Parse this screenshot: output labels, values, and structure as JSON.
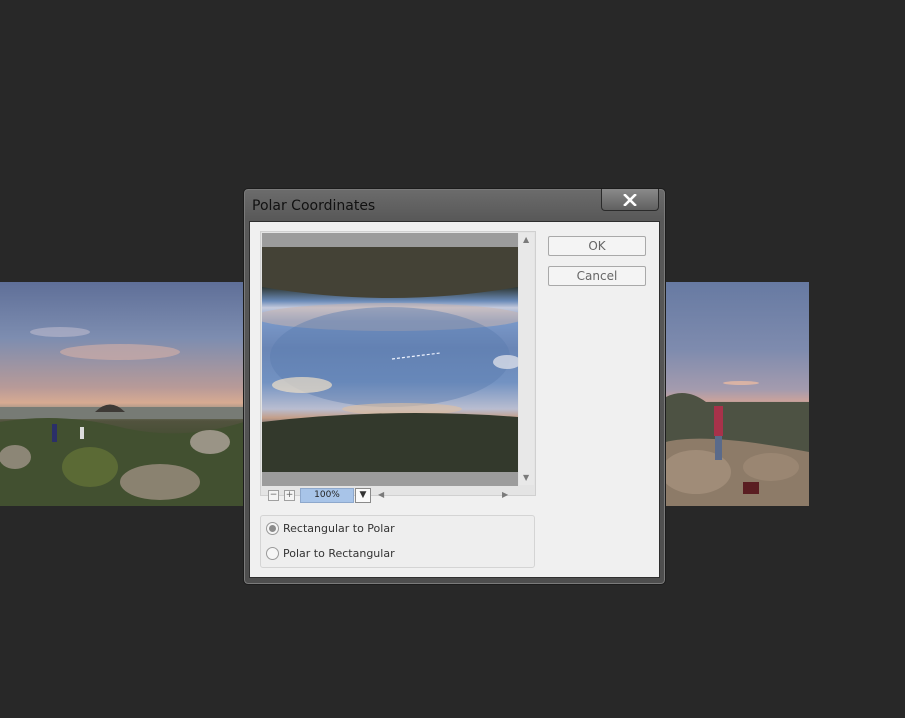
{
  "dialog": {
    "title": "Polar Coordinates",
    "ok_label": "OK",
    "cancel_label": "Cancel",
    "close_icon": "close-icon"
  },
  "preview": {
    "zoom_value": "100%",
    "zoom_out_label": "−",
    "zoom_in_label": "+"
  },
  "options": {
    "items": [
      {
        "label": "Rectangular to Polar",
        "selected": true
      },
      {
        "label": "Polar to Rectangular",
        "selected": false
      }
    ]
  },
  "colors": {
    "background": "#282828",
    "dialog_client": "#f0f0f0",
    "zoom_field": "#a8c4e8"
  }
}
